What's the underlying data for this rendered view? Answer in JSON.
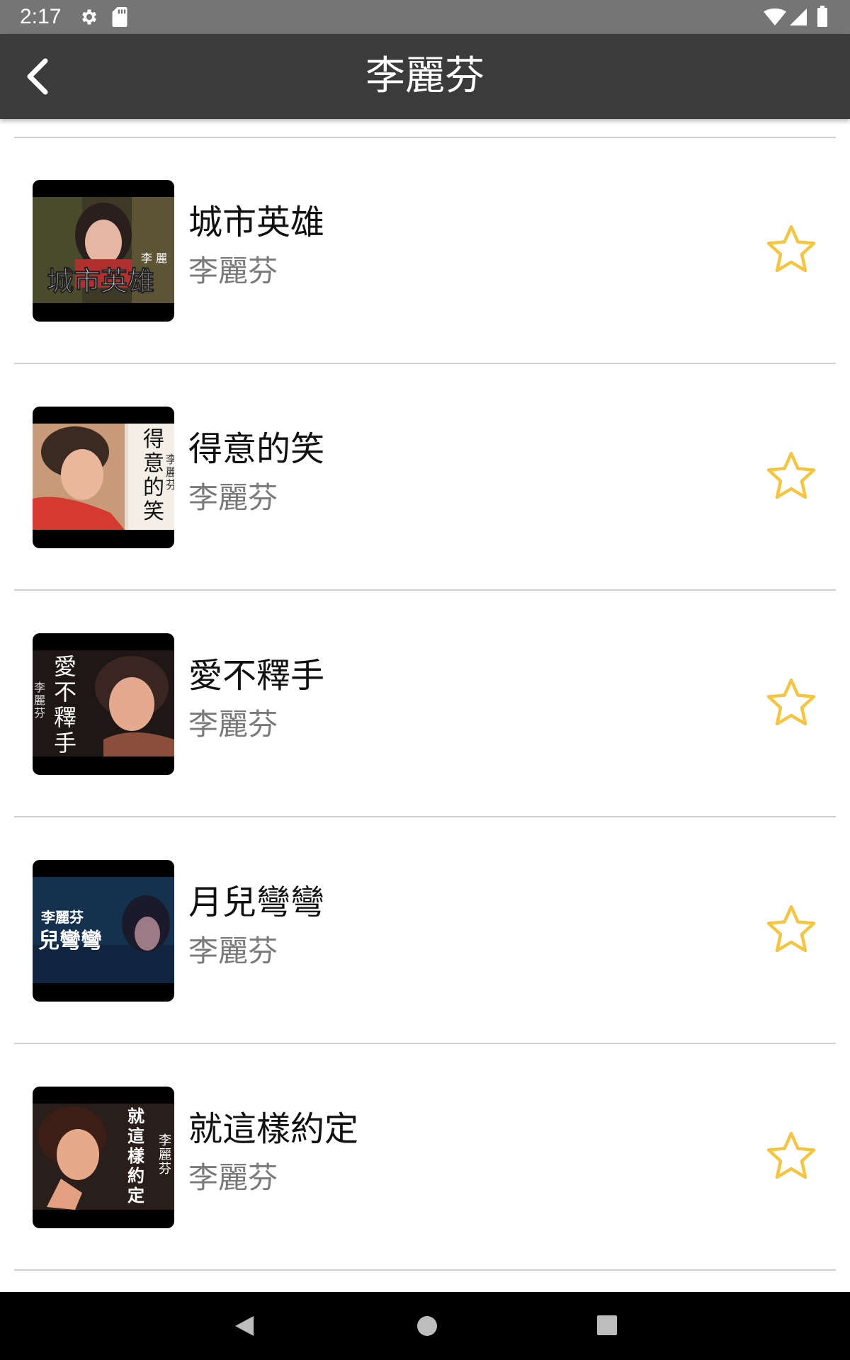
{
  "status_bar": {
    "time": "2:17",
    "icons": [
      "settings-gear-icon",
      "sd-card-icon",
      "wifi-icon",
      "cell-signal-icon",
      "battery-icon"
    ]
  },
  "app_bar": {
    "title": "李麗芬",
    "back_icon": "chevron-left-icon"
  },
  "songs": [
    {
      "title": "城市英雄",
      "artist": "李麗芬",
      "thumb_caption": "城市英雄",
      "thumb_artist": "李 麗",
      "favorite": false
    },
    {
      "title": "得意的笑",
      "artist": "李麗芬",
      "thumb_caption": "得意的笑",
      "thumb_artist": "李麗芬",
      "favorite": false
    },
    {
      "title": "愛不釋手",
      "artist": "李麗芬",
      "thumb_caption": "愛不釋手",
      "thumb_artist": "李麗芬",
      "favorite": false
    },
    {
      "title": "月兒彎彎",
      "artist": "李麗芬",
      "thumb_caption": "兒彎彎",
      "thumb_artist": "李麗芬",
      "favorite": false
    },
    {
      "title": "就這樣約定",
      "artist": "李麗芬",
      "thumb_caption": "就這樣約定",
      "thumb_artist": "李麗芬",
      "favorite": false
    }
  ],
  "colors": {
    "status_bar": "#757575",
    "app_bar": "#3b3b3b",
    "star": "#f5c542",
    "artist_text": "#7a7a7a",
    "divider": "#cfcfcf"
  },
  "nav_bar": {
    "icons": [
      "nav-back-icon",
      "nav-home-icon",
      "nav-recents-icon"
    ]
  }
}
